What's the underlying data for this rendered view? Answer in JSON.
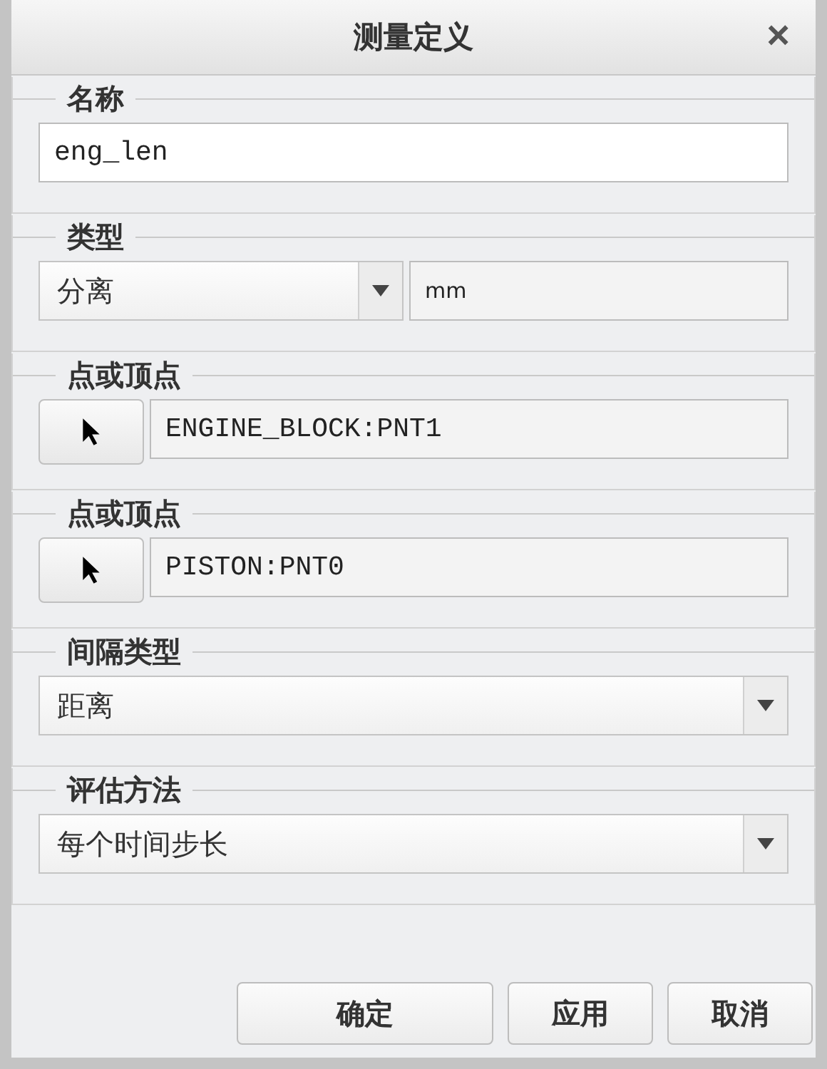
{
  "window": {
    "title": "测量定义",
    "close": "×"
  },
  "sections": [
    {
      "label": "名称",
      "kind": "text",
      "value": "eng_len"
    },
    {
      "label": "类型",
      "kind": "select_unit",
      "value": "分离",
      "unit": "mm"
    },
    {
      "label": "点或顶点",
      "kind": "picker",
      "value": "ENGINE_BLOCK:PNT1"
    },
    {
      "label": "点或顶点",
      "kind": "picker",
      "value": "PISTON:PNT0"
    },
    {
      "label": "间隔类型",
      "kind": "select",
      "value": "距离"
    },
    {
      "label": "评估方法",
      "kind": "select",
      "value": "每个时间步长"
    }
  ],
  "buttons": [
    "确定",
    "应用",
    "取消"
  ]
}
